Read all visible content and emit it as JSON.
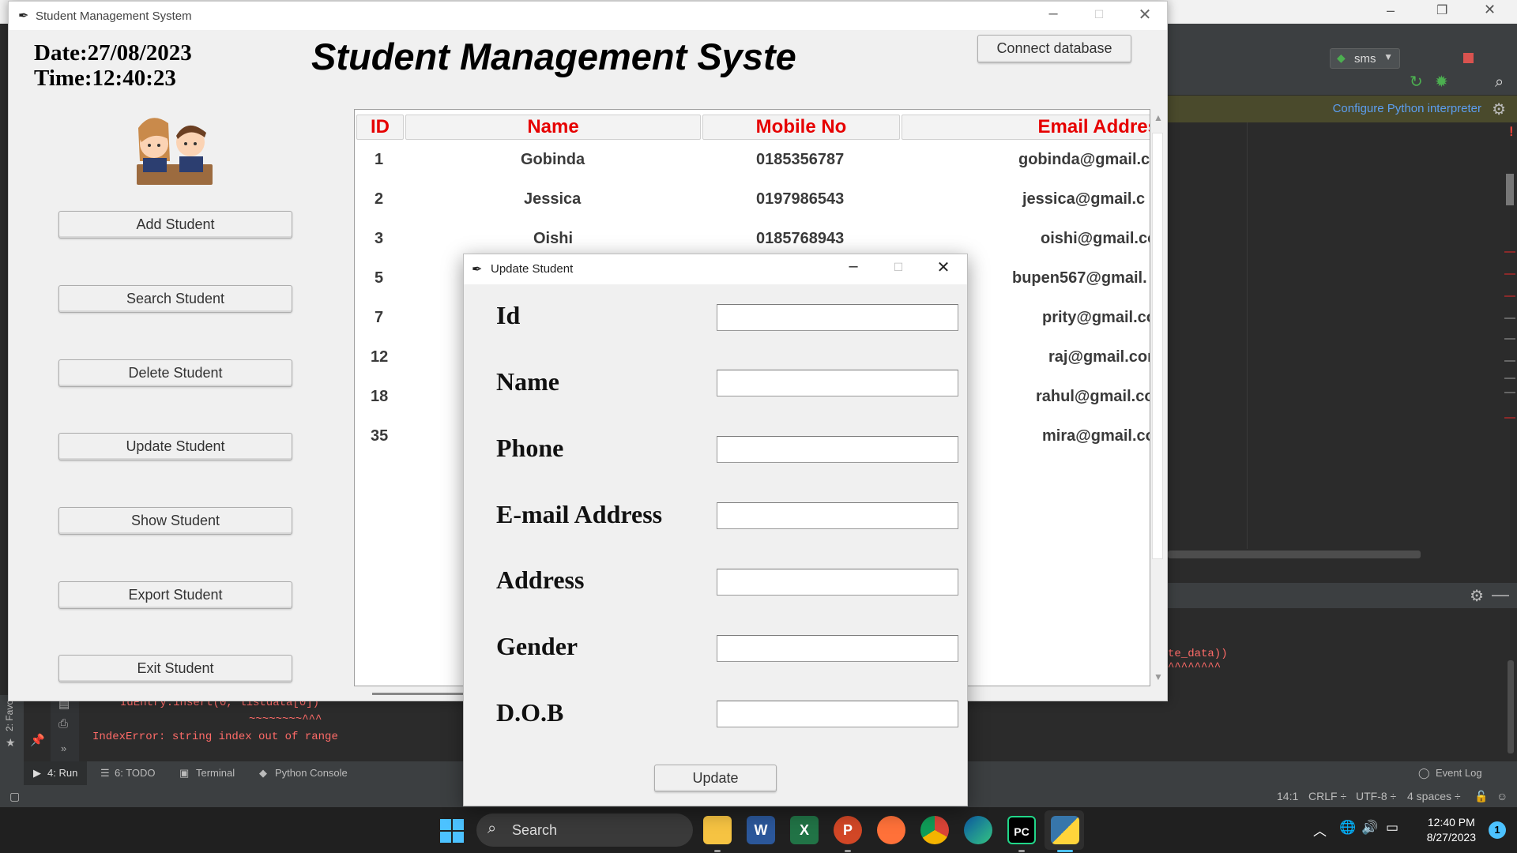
{
  "main_window": {
    "title": "Student Management System",
    "date": "Date:27/08/2023",
    "time": "Time:12:40:23",
    "heading": "Student Management Syste",
    "connect_label": "Connect database",
    "side_buttons": [
      "Add Student",
      "Search Student",
      "Delete Student",
      "Update Student",
      "Show Student",
      "Export Student",
      "Exit Student"
    ]
  },
  "table": {
    "columns": [
      "ID",
      "Name",
      "Mobile No",
      "Email Addres"
    ],
    "rows": [
      {
        "id": "1",
        "name": "Gobinda",
        "mobile": "0185356787",
        "email": "gobinda@gmail.c"
      },
      {
        "id": "2",
        "name": "Jessica",
        "mobile": "0197986543",
        "email": "jessica@gmail.c"
      },
      {
        "id": "3",
        "name": "Oishi",
        "mobile": "0185768943",
        "email": "oishi@gmail.co"
      },
      {
        "id": "5",
        "name": "",
        "mobile": "",
        "email": "bupen567@gmail."
      },
      {
        "id": "7",
        "name": "",
        "mobile": "",
        "email": "prity@gmail.co"
      },
      {
        "id": "12",
        "name": "",
        "mobile": "",
        "email": "raj@gmail.con"
      },
      {
        "id": "18",
        "name": "",
        "mobile": "",
        "email": "rahul@gmail.co"
      },
      {
        "id": "35",
        "name": "",
        "mobile": "",
        "email": "mira@gmail.co"
      }
    ]
  },
  "dialog": {
    "title": "Update Student",
    "fields": [
      {
        "label": "Id",
        "value": ""
      },
      {
        "label": "Name",
        "value": ""
      },
      {
        "label": "Phone",
        "value": ""
      },
      {
        "label": "E-mail Address",
        "value": ""
      },
      {
        "label": "Address",
        "value": ""
      },
      {
        "label": "Gender",
        "value": ""
      },
      {
        "label": "D.O.B",
        "value": ""
      }
    ],
    "update_label": "Update"
  },
  "ide": {
    "run_config": "sms",
    "banner": "Configure Python interpreter",
    "console": [
      "IdEntry.insert(0, listdata[0])",
      "~~~~~~~~^^^",
      "IndexError: string index out of range",
      "te_data))",
      "^^^^^^^^"
    ],
    "bottom_tabs": [
      "4: Run",
      "6: TODO",
      "Terminal",
      "Python Console"
    ],
    "event_log": "Event Log",
    "favorites": "2: Favo",
    "status": {
      "position": "14:1",
      "line_sep": "CRLF ÷",
      "encoding": "UTF-8 ÷",
      "indent": "4 spaces ÷"
    }
  },
  "taskbar": {
    "search": "Search",
    "time": "12:40 PM",
    "date": "8/27/2023",
    "notifications": "1"
  },
  "colors": {
    "header_red": "#e60000",
    "taskbar": "#202020",
    "ide_bg": "#2b2b2b"
  }
}
